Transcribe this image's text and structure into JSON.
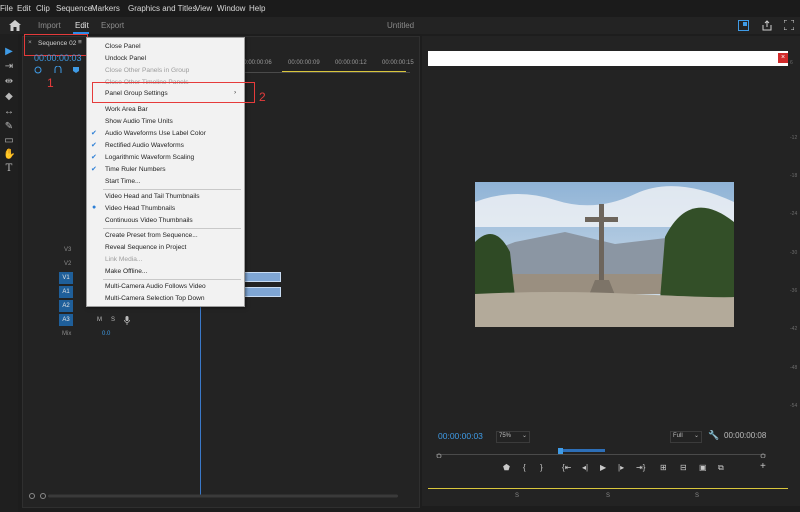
{
  "menubar": [
    "File",
    "Edit",
    "Clip",
    "Sequence",
    "Markers",
    "Graphics and Titles",
    "View",
    "Window",
    "Help"
  ],
  "header": {
    "tabs": [
      "Import",
      "Edit",
      "Export"
    ],
    "active_tab": "Edit",
    "doc_title": "Untitled"
  },
  "timeline": {
    "tab_label": "Sequence 02",
    "tab_close": "×",
    "tab_menu": "≡",
    "timecode": "00:00:00:03",
    "ruler_labels": [
      "00:00:00:06",
      "00:00:00:09",
      "00:00:00:12",
      "00:00:00:15"
    ],
    "tracks": [
      {
        "badge": "",
        "name": "V3"
      },
      {
        "badge": "",
        "name": "V2"
      },
      {
        "badge": "V1",
        "name": "V1"
      },
      {
        "badge": "A1",
        "name": "A1"
      },
      {
        "badge": "A2",
        "name": "A2"
      },
      {
        "badge": "A3",
        "name": "A3"
      }
    ],
    "audio_controls": {
      "m": "M",
      "s": "S"
    },
    "mix_label": "Mix",
    "mix_value": "0.0",
    "annotation_1": "1"
  },
  "context_menu": {
    "items": [
      {
        "label": "Close Panel",
        "checked": false,
        "disabled": false
      },
      {
        "label": "Undock Panel",
        "checked": false,
        "disabled": false
      },
      {
        "label": "Close Other Panels in Group",
        "checked": false,
        "disabled": true
      },
      {
        "label": "Close Other Timeline Panels",
        "checked": false,
        "disabled": true
      },
      {
        "label": "Panel Group Settings",
        "checked": false,
        "disabled": false,
        "submenu": true
      },
      {
        "label": "Work Area Bar",
        "checked": false,
        "disabled": false
      },
      {
        "label": "Show Audio Time Units",
        "checked": false,
        "disabled": false
      },
      {
        "label": "Audio Waveforms Use Label Color",
        "checked": true,
        "disabled": false
      },
      {
        "label": "Rectified Audio Waveforms",
        "checked": true,
        "disabled": false
      },
      {
        "label": "Logarithmic Waveform Scaling",
        "checked": true,
        "disabled": false
      },
      {
        "label": "Time Ruler Numbers",
        "checked": true,
        "disabled": false
      },
      {
        "label": "Start Time...",
        "checked": false,
        "disabled": false
      },
      {
        "label": "Video Head and Tail Thumbnails",
        "checked": false,
        "disabled": false
      },
      {
        "label": "Video Head Thumbnails",
        "checked": true,
        "radio": true,
        "disabled": false
      },
      {
        "label": "Continuous Video Thumbnails",
        "checked": false,
        "disabled": false
      },
      {
        "label": "Create Preset from Sequence...",
        "checked": false,
        "disabled": false
      },
      {
        "label": "Reveal Sequence in Project",
        "checked": false,
        "disabled": false
      },
      {
        "label": "Link Media...",
        "checked": false,
        "disabled": true
      },
      {
        "label": "Make Offline...",
        "checked": false,
        "disabled": false
      },
      {
        "label": "Multi-Camera Audio Follows Video",
        "checked": false,
        "disabled": false
      },
      {
        "label": "Multi-Camera Selection Top Down",
        "checked": false,
        "disabled": false
      }
    ],
    "submenu_arrow": "›",
    "annotation_2": "2"
  },
  "program": {
    "close_glyph": "×",
    "timecode": "00:00:00:03",
    "zoom": "75%",
    "resolution": "Full",
    "duration": "00:00:00:08",
    "scale_ticks": [
      "6",
      "-12",
      "-18",
      "-24",
      "-30",
      "-36",
      "-42",
      "-48",
      "-54"
    ],
    "timeline_labels": [
      "S",
      "S",
      "S"
    ]
  },
  "colors": {
    "accent": "#2d8ceb",
    "timecode": "#3f9be6",
    "annotation": "#e53b3b",
    "clip": "#7fa6d4"
  }
}
